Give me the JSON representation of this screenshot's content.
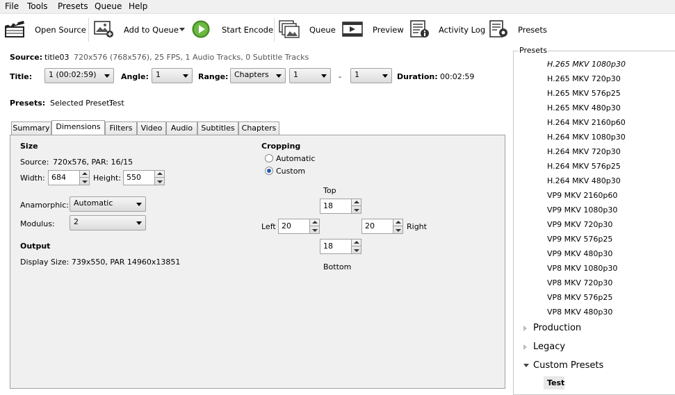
{
  "menu": [
    "File",
    "Tools",
    "Presets",
    "Queue",
    "Help"
  ],
  "toolbar": {
    "open_source": "Open Source",
    "add_to_queue": "Add to Queue",
    "start_encode": "Start Encode",
    "queue": "Queue",
    "preview": "Preview",
    "activity_log": "Activity Log",
    "presets": "Presets"
  },
  "source": {
    "label": "Source:",
    "name": "title03",
    "info": "720x576 (768x576), 25 FPS, 1 Audio Tracks, 0 Subtitle Tracks"
  },
  "title_row": {
    "title_label": "Title:",
    "title_value": "1 (00:02:59)",
    "angle_label": "Angle:",
    "angle_value": "1",
    "range_label": "Range:",
    "range_value": "Chapters",
    "range_start": "1",
    "range_sep": "-",
    "range_end": "1",
    "duration_label": "Duration:",
    "duration_value": "00:02:59"
  },
  "presets_row": {
    "label": "Presets:",
    "selected_label": "Selected Preset:",
    "selected_value": "Test"
  },
  "tabs": [
    "Summary",
    "Dimensions",
    "Filters",
    "Video",
    "Audio",
    "Subtitles",
    "Chapters"
  ],
  "dimensions": {
    "size_heading": "Size",
    "source_label": "Source:",
    "source_value": "720x576, PAR: 16/15",
    "width_label": "Width:",
    "width_value": "684",
    "height_label": "Height:",
    "height_value": "550",
    "anamorphic_label": "Anamorphic:",
    "anamorphic_value": "Automatic",
    "modulus_label": "Modulus:",
    "modulus_value": "2",
    "output_heading": "Output",
    "display_size": "Display Size: 739x550,  PAR 14960x13851",
    "cropping_heading": "Cropping",
    "automatic_label": "Automatic",
    "custom_label": "Custom",
    "cropping_mode": "Custom",
    "top_label": "Top",
    "top_value": "18",
    "left_label": "Left",
    "left_value": "20",
    "right_label": "Right",
    "right_value": "20",
    "bottom_label": "Bottom",
    "bottom_value": "18"
  },
  "presets_panel": {
    "title": "Presets",
    "items": [
      "H.265 MKV 1080p30",
      "H.265 MKV 720p30",
      "H.265 MKV 576p25",
      "H.265 MKV 480p30",
      "H.264 MKV 2160p60",
      "H.264 MKV 1080p30",
      "H.264 MKV 720p30",
      "H.264 MKV 576p25",
      "H.264 MKV 480p30",
      "VP9 MKV 2160p60",
      "VP9 MKV 1080p30",
      "VP9 MKV 720p30",
      "VP9 MKV 576p25",
      "VP9 MKV 480p30",
      "VP8 MKV 1080p30",
      "VP8 MKV 720p30",
      "VP8 MKV 576p25",
      "VP8 MKV 480p30"
    ],
    "groups": [
      "Production",
      "Legacy",
      "Custom Presets"
    ],
    "custom_item": "Test"
  }
}
